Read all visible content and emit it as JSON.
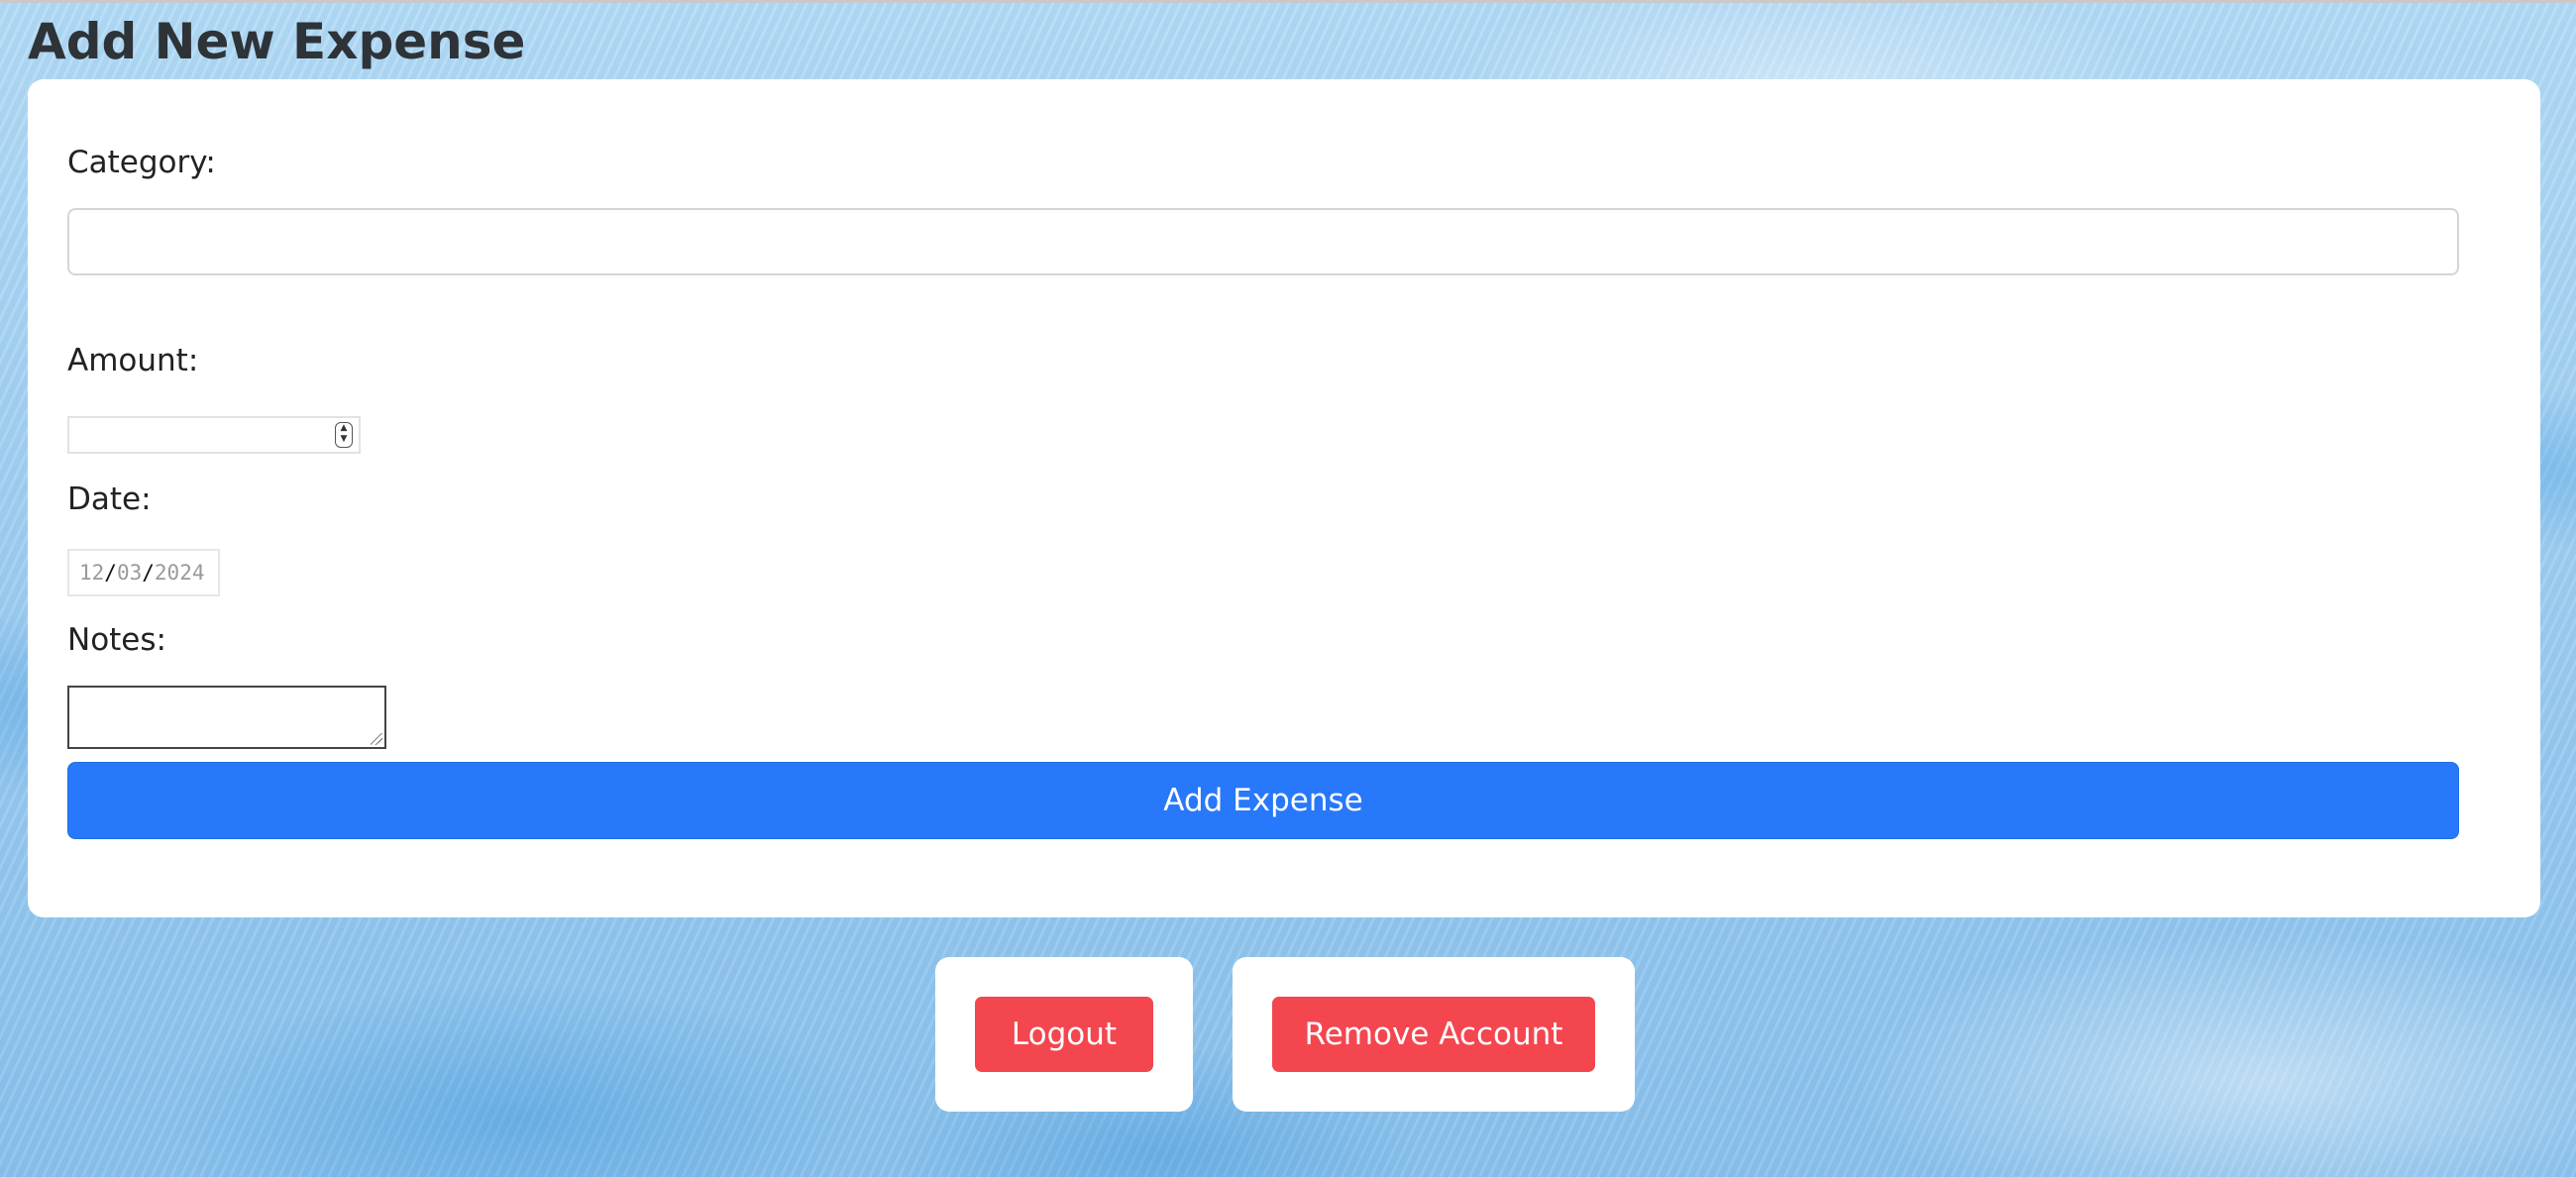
{
  "page": {
    "title": "Add New Expense",
    "background_color": "#a9d3f2"
  },
  "form": {
    "category": {
      "label": "Category:",
      "value": "",
      "placeholder": ""
    },
    "amount": {
      "label": "Amount:",
      "value": "",
      "placeholder": ""
    },
    "date": {
      "label": "Date:",
      "month": "12",
      "day": "03",
      "year": "2024",
      "separator": "/"
    },
    "notes": {
      "label": "Notes:",
      "value": ""
    },
    "submit_label": "Add Expense",
    "submit_color": "#2778fb"
  },
  "account_actions": {
    "logout_label": "Logout",
    "remove_label": "Remove Account",
    "button_color": "#f4464f"
  },
  "icons": {
    "stepper_up": "▲",
    "stepper_down": "▼"
  }
}
